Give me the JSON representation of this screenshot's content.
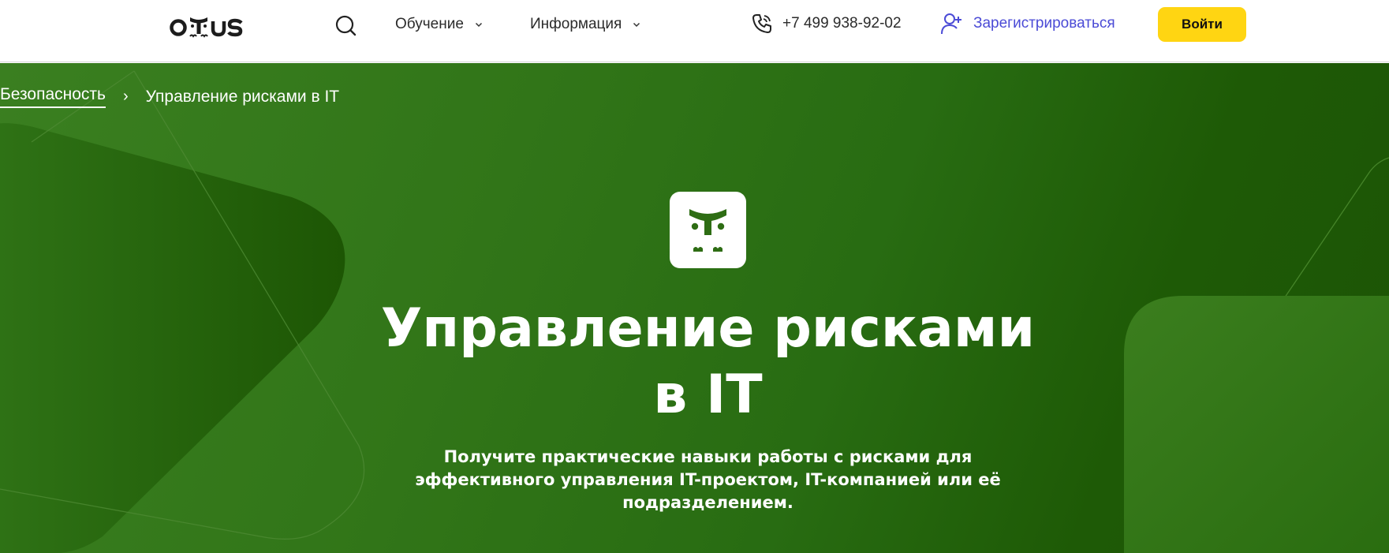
{
  "header": {
    "logo_text": "otus",
    "nav": [
      {
        "label": "Обучение"
      },
      {
        "label": "Информация"
      }
    ],
    "phone": "+7 499 938-92-02",
    "register_label": "Зарегистрироваться",
    "login_label": "Войти"
  },
  "icons": {
    "search": "search-icon",
    "chevron": "chevron-down-icon",
    "phone": "phone-icon",
    "add_user": "add-user-icon",
    "course": "otus-mascot-icon"
  },
  "breadcrumb": {
    "parent": "Безопасность",
    "separator": "›",
    "current": "Управление рисками в IT"
  },
  "hero": {
    "title_line1": "Управление рисками",
    "title_line2": "в IT",
    "subtitle": "Получите практические навыки работы с рисками для эффективного управления IT-проектом, IT-компанией или её подразделением."
  },
  "colors": {
    "accent_yellow": "#ffd512",
    "register_blue": "#4b4bd6",
    "hero_green": "#317518",
    "hero_green_dark": "#1c5405"
  }
}
